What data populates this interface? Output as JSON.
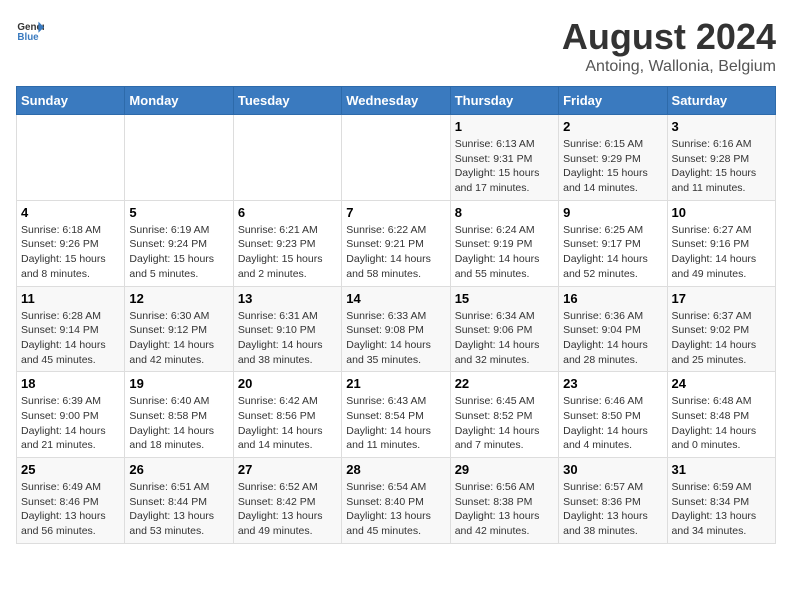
{
  "header": {
    "logo_general": "General",
    "logo_blue": "Blue",
    "title": "August 2024",
    "subtitle": "Antoing, Wallonia, Belgium"
  },
  "days_of_week": [
    "Sunday",
    "Monday",
    "Tuesday",
    "Wednesday",
    "Thursday",
    "Friday",
    "Saturday"
  ],
  "weeks": [
    {
      "days": [
        {
          "num": "",
          "info": ""
        },
        {
          "num": "",
          "info": ""
        },
        {
          "num": "",
          "info": ""
        },
        {
          "num": "",
          "info": ""
        },
        {
          "num": "1",
          "info": "Sunrise: 6:13 AM\nSunset: 9:31 PM\nDaylight: 15 hours\nand 17 minutes."
        },
        {
          "num": "2",
          "info": "Sunrise: 6:15 AM\nSunset: 9:29 PM\nDaylight: 15 hours\nand 14 minutes."
        },
        {
          "num": "3",
          "info": "Sunrise: 6:16 AM\nSunset: 9:28 PM\nDaylight: 15 hours\nand 11 minutes."
        }
      ]
    },
    {
      "days": [
        {
          "num": "4",
          "info": "Sunrise: 6:18 AM\nSunset: 9:26 PM\nDaylight: 15 hours\nand 8 minutes."
        },
        {
          "num": "5",
          "info": "Sunrise: 6:19 AM\nSunset: 9:24 PM\nDaylight: 15 hours\nand 5 minutes."
        },
        {
          "num": "6",
          "info": "Sunrise: 6:21 AM\nSunset: 9:23 PM\nDaylight: 15 hours\nand 2 minutes."
        },
        {
          "num": "7",
          "info": "Sunrise: 6:22 AM\nSunset: 9:21 PM\nDaylight: 14 hours\nand 58 minutes."
        },
        {
          "num": "8",
          "info": "Sunrise: 6:24 AM\nSunset: 9:19 PM\nDaylight: 14 hours\nand 55 minutes."
        },
        {
          "num": "9",
          "info": "Sunrise: 6:25 AM\nSunset: 9:17 PM\nDaylight: 14 hours\nand 52 minutes."
        },
        {
          "num": "10",
          "info": "Sunrise: 6:27 AM\nSunset: 9:16 PM\nDaylight: 14 hours\nand 49 minutes."
        }
      ]
    },
    {
      "days": [
        {
          "num": "11",
          "info": "Sunrise: 6:28 AM\nSunset: 9:14 PM\nDaylight: 14 hours\nand 45 minutes."
        },
        {
          "num": "12",
          "info": "Sunrise: 6:30 AM\nSunset: 9:12 PM\nDaylight: 14 hours\nand 42 minutes."
        },
        {
          "num": "13",
          "info": "Sunrise: 6:31 AM\nSunset: 9:10 PM\nDaylight: 14 hours\nand 38 minutes."
        },
        {
          "num": "14",
          "info": "Sunrise: 6:33 AM\nSunset: 9:08 PM\nDaylight: 14 hours\nand 35 minutes."
        },
        {
          "num": "15",
          "info": "Sunrise: 6:34 AM\nSunset: 9:06 PM\nDaylight: 14 hours\nand 32 minutes."
        },
        {
          "num": "16",
          "info": "Sunrise: 6:36 AM\nSunset: 9:04 PM\nDaylight: 14 hours\nand 28 minutes."
        },
        {
          "num": "17",
          "info": "Sunrise: 6:37 AM\nSunset: 9:02 PM\nDaylight: 14 hours\nand 25 minutes."
        }
      ]
    },
    {
      "days": [
        {
          "num": "18",
          "info": "Sunrise: 6:39 AM\nSunset: 9:00 PM\nDaylight: 14 hours\nand 21 minutes."
        },
        {
          "num": "19",
          "info": "Sunrise: 6:40 AM\nSunset: 8:58 PM\nDaylight: 14 hours\nand 18 minutes."
        },
        {
          "num": "20",
          "info": "Sunrise: 6:42 AM\nSunset: 8:56 PM\nDaylight: 14 hours\nand 14 minutes."
        },
        {
          "num": "21",
          "info": "Sunrise: 6:43 AM\nSunset: 8:54 PM\nDaylight: 14 hours\nand 11 minutes."
        },
        {
          "num": "22",
          "info": "Sunrise: 6:45 AM\nSunset: 8:52 PM\nDaylight: 14 hours\nand 7 minutes."
        },
        {
          "num": "23",
          "info": "Sunrise: 6:46 AM\nSunset: 8:50 PM\nDaylight: 14 hours\nand 4 minutes."
        },
        {
          "num": "24",
          "info": "Sunrise: 6:48 AM\nSunset: 8:48 PM\nDaylight: 14 hours\nand 0 minutes."
        }
      ]
    },
    {
      "days": [
        {
          "num": "25",
          "info": "Sunrise: 6:49 AM\nSunset: 8:46 PM\nDaylight: 13 hours\nand 56 minutes."
        },
        {
          "num": "26",
          "info": "Sunrise: 6:51 AM\nSunset: 8:44 PM\nDaylight: 13 hours\nand 53 minutes."
        },
        {
          "num": "27",
          "info": "Sunrise: 6:52 AM\nSunset: 8:42 PM\nDaylight: 13 hours\nand 49 minutes."
        },
        {
          "num": "28",
          "info": "Sunrise: 6:54 AM\nSunset: 8:40 PM\nDaylight: 13 hours\nand 45 minutes."
        },
        {
          "num": "29",
          "info": "Sunrise: 6:56 AM\nSunset: 8:38 PM\nDaylight: 13 hours\nand 42 minutes."
        },
        {
          "num": "30",
          "info": "Sunrise: 6:57 AM\nSunset: 8:36 PM\nDaylight: 13 hours\nand 38 minutes."
        },
        {
          "num": "31",
          "info": "Sunrise: 6:59 AM\nSunset: 8:34 PM\nDaylight: 13 hours\nand 34 minutes."
        }
      ]
    }
  ]
}
